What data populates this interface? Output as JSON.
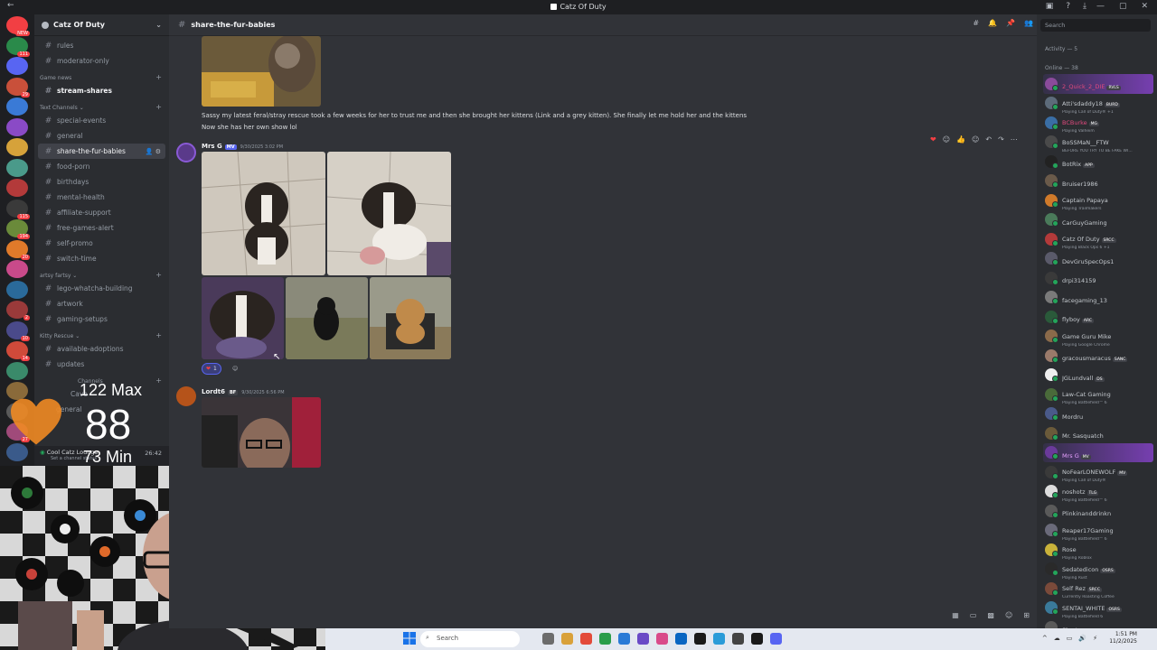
{
  "window": {
    "title": "Catz Of Duty",
    "back_label": "←",
    "sys_icons": [
      "▣",
      "?",
      "⤓"
    ],
    "controls": [
      "—",
      "▢",
      "✕"
    ]
  },
  "server": {
    "name": "Catz Of Duty",
    "guild_badges": [
      "NEW",
      "111",
      "",
      "29",
      "",
      "",
      "",
      "",
      "",
      "115",
      "194",
      "20",
      "",
      "",
      "2",
      "10",
      "14",
      "",
      "",
      "",
      "27",
      ""
    ]
  },
  "channels": {
    "top": [
      {
        "name": "rules",
        "style": "normal"
      },
      {
        "name": "moderator-only",
        "style": "normal"
      }
    ],
    "cat_game_news": "Game news",
    "game_news": [
      {
        "name": "stream-shares",
        "style": "bold"
      }
    ],
    "cat_text": "Text Channels",
    "text": [
      {
        "name": "special-events",
        "style": "normal"
      },
      {
        "name": "general",
        "style": "normal"
      },
      {
        "name": "share-the-fur-babies",
        "style": "active"
      },
      {
        "name": "food-porn",
        "style": "normal"
      },
      {
        "name": "birthdays",
        "style": "normal"
      },
      {
        "name": "mental-health",
        "style": "normal"
      },
      {
        "name": "affiliate-support",
        "style": "normal"
      },
      {
        "name": "free-games-alert",
        "style": "normal"
      },
      {
        "name": "self-promo",
        "style": "normal"
      },
      {
        "name": "switch-time",
        "style": "normal"
      }
    ],
    "cat_artsy": "artsy fartsy",
    "artsy": [
      {
        "name": "lego-whatcha-building",
        "style": "normal"
      },
      {
        "name": "artwork",
        "style": "normal"
      },
      {
        "name": "gaming-setups",
        "style": "normal"
      }
    ],
    "cat_kitty": "Kitty Rescue",
    "kitty": [
      {
        "name": "available-adoptions",
        "style": "normal"
      },
      {
        "name": "updates",
        "style": "normal"
      }
    ],
    "partial_cave": "Cave",
    "partial_general": "general",
    "cat_channels": "Channels",
    "voice_name": "Cool Catz Lounge",
    "voice_sub": "Set a channel status",
    "voice_time": "26:42"
  },
  "heart_rate": {
    "max": "122 Max",
    "current": "88",
    "min": "73 Min"
  },
  "chat": {
    "channel_name": "share-the-fur-babies",
    "message1_text_line1": "Sassy my latest feral/stray rescue took a few weeks for her to trust me and then she brought her kittens (Link  and a grey kitten). She finally let me hold her and the kittens",
    "message1_text_line2": "Now she has her own show lol",
    "message2_author": "Mrs G",
    "message2_tag": "MV",
    "message2_time": "9/30/2025 3:02 PM",
    "reaction_count": "1",
    "message3_author": "Lordt6",
    "message3_tag": "BF",
    "message3_time": "9/30/2025 6:56 PM",
    "action_icons": [
      "❤",
      "☺",
      "👍",
      "☺",
      "↶",
      "↷",
      "⋯"
    ],
    "header_icons": [
      "#",
      "🔔",
      "📌",
      "👥"
    ],
    "bottom_icons": [
      "▦",
      "▭",
      "▩",
      "☺",
      "⊞"
    ]
  },
  "members": {
    "search_placeholder": "Search",
    "activity_label": "Activity — 5",
    "online_label": "Online — 38",
    "list": [
      {
        "name": "2_Quick_2_DIE",
        "tag": "RVLS",
        "status": "",
        "color": "#e0497d",
        "av": "#8a4b9a"
      },
      {
        "name": "Atti'sdaddy18",
        "tag": "BURD",
        "status": "Playing Call of Duty® +1",
        "color": "#c4c9ce",
        "av": "#5d6b7a"
      },
      {
        "name": "BCBurke",
        "tag": "MG",
        "status": "Playing Valheim",
        "color": "#e0497d",
        "av": "#3a6ea5"
      },
      {
        "name": "BoSSMaN__FTW",
        "tag": "",
        "status": "BEFORE YOU TRY TO BE FAKE WI...",
        "color": "#c4c9ce",
        "av": "#4a4a4a"
      },
      {
        "name": "BotRix",
        "tag": "APP",
        "status": "",
        "color": "#c4c9ce",
        "av": "#222222"
      },
      {
        "name": "Bruiser1986",
        "tag": "",
        "status": "",
        "color": "#c4c9ce",
        "av": "#6a5a4a"
      },
      {
        "name": "Captain Papaya",
        "tag": "",
        "status": "Playing Trailmakers",
        "color": "#c4c9ce",
        "av": "#d07a2a"
      },
      {
        "name": "CarGuyGaming",
        "tag": "",
        "status": "",
        "color": "#c4c9ce",
        "av": "#4a7a5a"
      },
      {
        "name": "Catz Of Duty",
        "tag": "SRCC",
        "status": "Playing Black Ops 6 +1",
        "color": "#c4c9ce",
        "av": "#b33a3a"
      },
      {
        "name": "DevGruSpecOps1",
        "tag": "",
        "status": "",
        "color": "#c4c9ce",
        "av": "#5a5a6a"
      },
      {
        "name": "drpi314159",
        "tag": "",
        "status": "",
        "color": "#c4c9ce",
        "av": "#3a3a3a"
      },
      {
        "name": "facegaming_13",
        "tag": "",
        "status": "",
        "color": "#c4c9ce",
        "av": "#7a7a7a"
      },
      {
        "name": "flyboy",
        "tag": "ARC",
        "status": "",
        "color": "#c4c9ce",
        "av": "#2a5a3a"
      },
      {
        "name": "Game Guru Mike",
        "tag": "",
        "status": "Playing Google Chrome",
        "color": "#c4c9ce",
        "av": "#8a6a4a"
      },
      {
        "name": "gracousmaracus",
        "tag": "SANC",
        "status": "",
        "color": "#c4c9ce",
        "av": "#9a7a6a"
      },
      {
        "name": "JGLundvall",
        "tag": "DS",
        "status": "",
        "color": "#c4c9ce",
        "av": "#eeeeee"
      },
      {
        "name": "Law-Cat Gaming",
        "tag": "",
        "status": "Playing Battlefield™ 6",
        "color": "#c4c9ce",
        "av": "#4a6a3a"
      },
      {
        "name": "Mordru",
        "tag": "",
        "status": "",
        "color": "#c4c9ce",
        "av": "#4a5a8a"
      },
      {
        "name": "Mr. Sasquatch",
        "tag": "",
        "status": "",
        "color": "#c4c9ce",
        "av": "#6a5a3a"
      },
      {
        "name": "Mrs G",
        "tag": "MV",
        "status": "",
        "color": "#e7a0ff",
        "av": "#6a3a9a"
      },
      {
        "name": "NoFearLONEWOLF",
        "tag": "MV",
        "status": "Playing Call of Duty®",
        "color": "#c4c9ce",
        "av": "#3a3a3a"
      },
      {
        "name": "noshotz",
        "tag": "TLG",
        "status": "Playing Battlefield™ 6",
        "color": "#c4c9ce",
        "av": "#dddddd"
      },
      {
        "name": "Plinkinanddrinkn",
        "tag": "",
        "status": "",
        "color": "#c4c9ce",
        "av": "#5a5a5a"
      },
      {
        "name": "Reaper17Gaming",
        "tag": "",
        "status": "Playing Battlefield™ 6",
        "color": "#c4c9ce",
        "av": "#6a6a7a"
      },
      {
        "name": "Rose",
        "tag": "",
        "status": "Playing Roblox",
        "color": "#c4c9ce",
        "av": "#c9b23a"
      },
      {
        "name": "Sedatedicon",
        "tag": "OSRS",
        "status": "Playing Rust",
        "color": "#c4c9ce",
        "av": "#2a2a2a"
      },
      {
        "name": "Self Rez",
        "tag": "SRCC",
        "status": "Currently Roasting Coffee",
        "color": "#c4c9ce",
        "av": "#7a4a3a"
      },
      {
        "name": "SENTAI_WHITE",
        "tag": "OSRS",
        "status": "Playing Battlefield 6",
        "color": "#c4c9ce",
        "av": "#3a7a9a"
      },
      {
        "name": "Shortyvsp",
        "tag": "",
        "status": "",
        "color": "#c4c9ce",
        "av": "#5a5a5a"
      }
    ]
  },
  "taskbar": {
    "search_placeholder": "Search",
    "time": "1:51 PM",
    "date": "11/2/2025",
    "app_colors": [
      "#6c6c6c",
      "#d9a13a",
      "#e34a3a",
      "#2a9d4a",
      "#2a7ad6",
      "#6a4ac6",
      "#d94a8a",
      "#0a66c2",
      "#1a1a1a",
      "#2a9bd8",
      "#444444",
      "#1a1a1a",
      "#5865f2"
    ],
    "tray_icons": [
      "^",
      "☁",
      "▭",
      "🔊",
      "⚡"
    ]
  }
}
